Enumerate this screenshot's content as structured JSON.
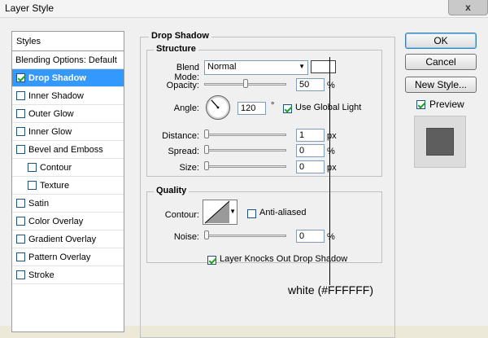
{
  "window": {
    "title": "Layer Style",
    "close_glyph": "x"
  },
  "styles_list": {
    "header": "Styles",
    "blending_options": "Blending Options: Default",
    "items": [
      {
        "label": "Drop Shadow",
        "checked": true,
        "selected": true
      },
      {
        "label": "Inner Shadow",
        "checked": false
      },
      {
        "label": "Outer Glow",
        "checked": false
      },
      {
        "label": "Inner Glow",
        "checked": false
      },
      {
        "label": "Bevel and Emboss",
        "checked": false
      },
      {
        "label": "Contour",
        "checked": false,
        "indent": true
      },
      {
        "label": "Texture",
        "checked": false,
        "indent": true
      },
      {
        "label": "Satin",
        "checked": false
      },
      {
        "label": "Color Overlay",
        "checked": false
      },
      {
        "label": "Gradient Overlay",
        "checked": false
      },
      {
        "label": "Pattern Overlay",
        "checked": false
      },
      {
        "label": "Stroke",
        "checked": false
      }
    ]
  },
  "drop_shadow": {
    "title": "Drop Shadow",
    "structure": {
      "title": "Structure",
      "blend_mode_label": "Blend Mode:",
      "blend_mode_value": "Normal",
      "shadow_color": "#FFFFFF",
      "opacity_label": "Opacity:",
      "opacity_value": "50",
      "opacity_unit": "%",
      "angle_label": "Angle:",
      "angle_value": "120",
      "angle_unit": "°",
      "use_global_light_label": "Use Global Light",
      "use_global_light_checked": true,
      "distance_label": "Distance:",
      "distance_value": "1",
      "distance_unit": "px",
      "spread_label": "Spread:",
      "spread_value": "0",
      "spread_unit": "%",
      "size_label": "Size:",
      "size_value": "0",
      "size_unit": "px"
    },
    "quality": {
      "title": "Quality",
      "contour_label": "Contour:",
      "anti_aliased_label": "Anti-aliased",
      "anti_aliased_checked": false,
      "noise_label": "Noise:",
      "noise_value": "0",
      "noise_unit": "%"
    },
    "knockout_label": "Layer Knocks Out Drop Shadow",
    "knockout_checked": true
  },
  "buttons": {
    "ok": "OK",
    "cancel": "Cancel",
    "new_style": "New Style..."
  },
  "preview": {
    "label": "Preview",
    "checked": true
  },
  "annotation": "white (#FFFFFF)"
}
